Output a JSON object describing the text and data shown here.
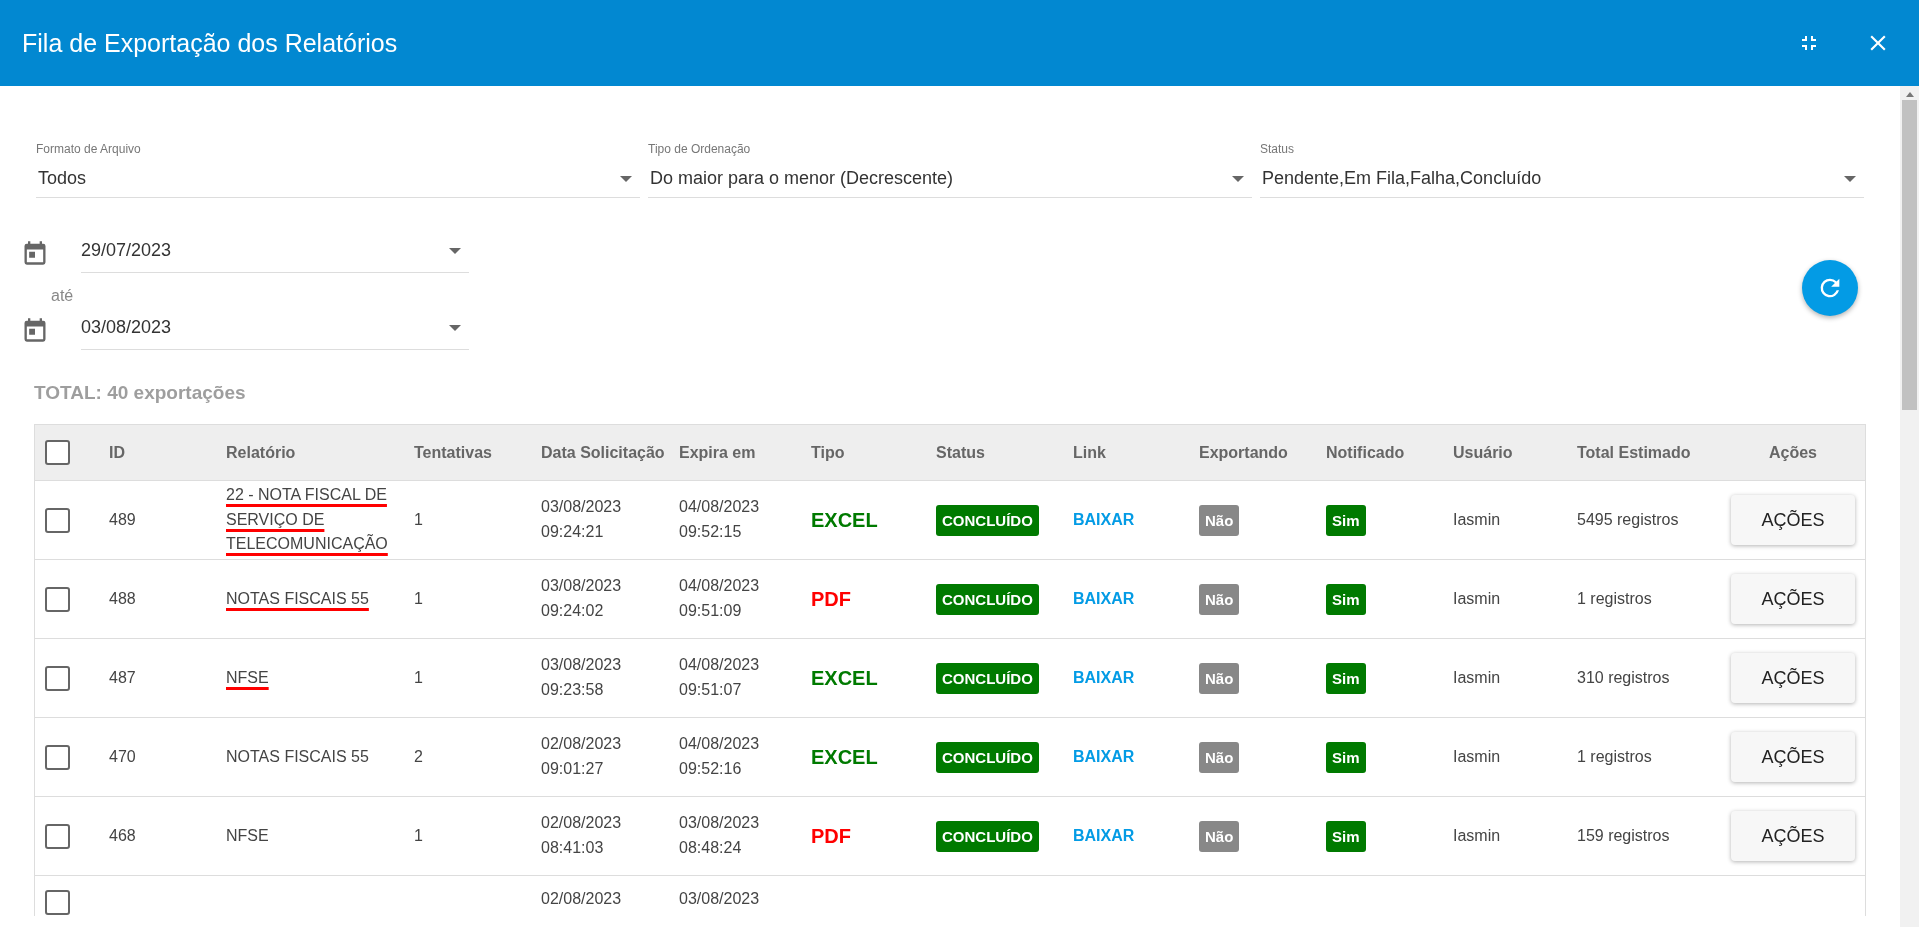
{
  "window": {
    "title": "Fila de Exportação dos Relatórios"
  },
  "filters": [
    {
      "label": "Formato de Arquivo",
      "value": "Todos"
    },
    {
      "label": "Tipo de Ordenação",
      "value": "Do maior para o menor (Decrescente)"
    },
    {
      "label": "Status",
      "value": "Pendente,Em Fila,Falha,Concluído"
    }
  ],
  "date_range": {
    "from": "29/07/2023",
    "separator": "até",
    "to": "03/08/2023"
  },
  "total": "TOTAL: 40 exportações",
  "table": {
    "select_all_checked": false,
    "columns": [
      "ID",
      "Relatório",
      "Tentativas",
      "Data Solicitação",
      "Expira em",
      "Tipo",
      "Status",
      "Link",
      "Exportando",
      "Notificado",
      "Usuário",
      "Total Estimado",
      "Ações"
    ],
    "rows": [
      {
        "checked": false,
        "id": "489",
        "report": "22 - NOTA FISCAL DE SERVIÇO DE TELECOMUNICAÇÃO",
        "underlined": true,
        "attempts": "1",
        "requested": [
          "03/08/2023",
          "09:24:21"
        ],
        "expires": [
          "04/08/2023",
          "09:52:15"
        ],
        "type": {
          "label": "EXCEL",
          "kind": "excel"
        },
        "status": "CONCLUÍDO",
        "link": "BAIXAR",
        "exporting": {
          "label": "Não",
          "on": false
        },
        "notified": {
          "label": "Sim",
          "on": true
        },
        "user": "Iasmin",
        "total": "5495 registros",
        "action": "AÇÕES"
      },
      {
        "checked": false,
        "id": "488",
        "report": "NOTAS FISCAIS 55",
        "underlined": true,
        "attempts": "1",
        "requested": [
          "03/08/2023",
          "09:24:02"
        ],
        "expires": [
          "04/08/2023",
          "09:51:09"
        ],
        "type": {
          "label": "PDF",
          "kind": "pdf"
        },
        "status": "CONCLUÍDO",
        "link": "BAIXAR",
        "exporting": {
          "label": "Não",
          "on": false
        },
        "notified": {
          "label": "Sim",
          "on": true
        },
        "user": "Iasmin",
        "total": "1 registros",
        "action": "AÇÕES"
      },
      {
        "checked": false,
        "id": "487",
        "report": "NFSE",
        "underlined": true,
        "attempts": "1",
        "requested": [
          "03/08/2023",
          "09:23:58"
        ],
        "expires": [
          "04/08/2023",
          "09:51:07"
        ],
        "type": {
          "label": "EXCEL",
          "kind": "excel"
        },
        "status": "CONCLUÍDO",
        "link": "BAIXAR",
        "exporting": {
          "label": "Não",
          "on": false
        },
        "notified": {
          "label": "Sim",
          "on": true
        },
        "user": "Iasmin",
        "total": "310 registros",
        "action": "AÇÕES"
      },
      {
        "checked": false,
        "id": "470",
        "report": "NOTAS FISCAIS 55",
        "underlined": false,
        "attempts": "2",
        "requested": [
          "02/08/2023",
          "09:01:27"
        ],
        "expires": [
          "04/08/2023",
          "09:52:16"
        ],
        "type": {
          "label": "EXCEL",
          "kind": "excel"
        },
        "status": "CONCLUÍDO",
        "link": "BAIXAR",
        "exporting": {
          "label": "Não",
          "on": false
        },
        "notified": {
          "label": "Sim",
          "on": true
        },
        "user": "Iasmin",
        "total": "1 registros",
        "action": "AÇÕES"
      },
      {
        "checked": false,
        "id": "468",
        "report": "NFSE",
        "underlined": false,
        "attempts": "1",
        "requested": [
          "02/08/2023",
          "08:41:03"
        ],
        "expires": [
          "03/08/2023",
          "08:48:24"
        ],
        "type": {
          "label": "PDF",
          "kind": "pdf"
        },
        "status": "CONCLUÍDO",
        "link": "BAIXAR",
        "exporting": {
          "label": "Não",
          "on": false
        },
        "notified": {
          "label": "Sim",
          "on": true
        },
        "user": "Iasmin",
        "total": "159 registros",
        "action": "AÇÕES"
      }
    ],
    "partial_row": {
      "checked": false,
      "requested": "02/08/2023",
      "expires": "03/08/2023"
    }
  }
}
